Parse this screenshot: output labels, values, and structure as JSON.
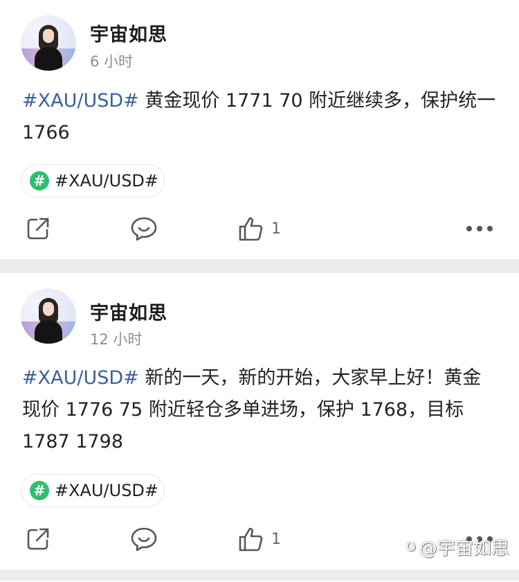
{
  "posts": [
    {
      "author": "宇宙如思",
      "time": "6 小时",
      "tag": "#XAU/USD#",
      "text": " 黄金现价 1771 70 附近继续多，保护统一1766",
      "topic": "#XAU/USD#",
      "like_count": "1"
    },
    {
      "author": "宇宙如思",
      "time": "12 小时",
      "tag": "#XAU/USD#",
      "text": " 新的一天，新的开始，大家早上好！黄金现价 1776 75 附近轻仓多单进场，保护 1768，目标 1787 1798",
      "topic": "#XAU/USD#",
      "like_count": "1"
    }
  ],
  "icons": {
    "topic": "hashtag-icon",
    "share": "share-icon",
    "comment": "comment-icon",
    "like": "thumbs-up-icon",
    "more": "more-icon"
  },
  "colors": {
    "tag_link": "#3a5f9c",
    "topic_badge": "#2fbf6c",
    "divider": "#ececec"
  },
  "watermark": "@宇宙如思"
}
